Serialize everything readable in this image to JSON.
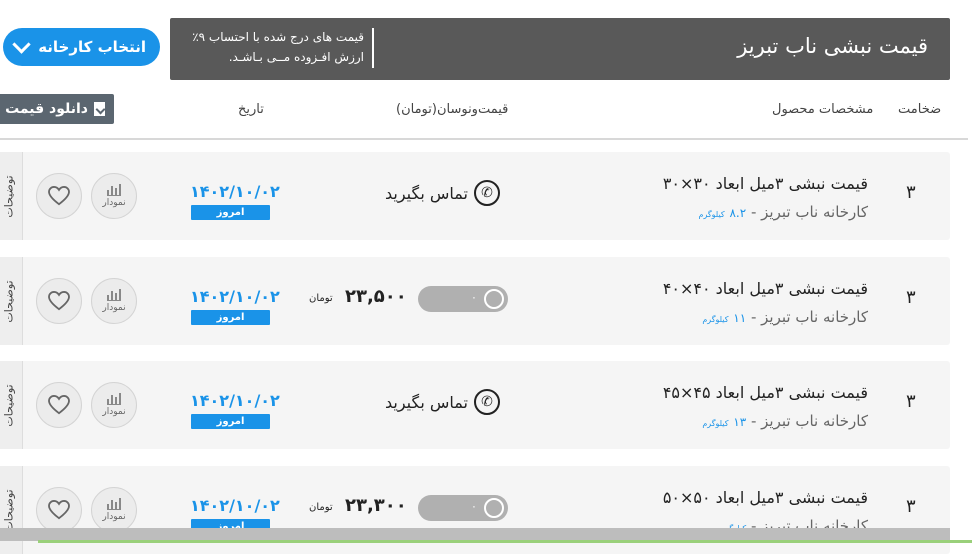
{
  "header": {
    "title": "قیمت نبشی ناب تبریز",
    "vat_note": "قیمت های درج شده با احتساب ۹٪ ارزش افـزوده مــی بـاشـد.",
    "select_factory_label": "انتخاب کارخانه"
  },
  "columns": {
    "thickness": "ضخامت",
    "product": "مشخصات محصول",
    "price": "قیمت‌ونوسان(تومان)",
    "date": "تاریخ",
    "download": "دانلود قیمت"
  },
  "labels": {
    "notes": "توضیحات",
    "chart": "نمودار",
    "today": "امروز",
    "toman": "تومان",
    "weight_unit": "کیلوگرم"
  },
  "rows": [
    {
      "thickness": "۳",
      "name": "قیمت نبشی ۳میل ابعاد ۳۰×۳۰",
      "sub": "کارخانه ناب تبریز -",
      "weight": "۸.۲",
      "date": "۱۴۰۲/۱۰/۰۲",
      "price_type": "call",
      "call_label": "تماس بگیرید"
    },
    {
      "thickness": "۳",
      "name": "قیمت نبشی ۳میل ابعاد ۴۰×۴۰",
      "sub": "کارخانه ناب تبریز -",
      "weight": "۱۱",
      "date": "۱۴۰۲/۱۰/۰۲",
      "price_type": "price",
      "price": "۲۳,۵۰۰",
      "change": "۰"
    },
    {
      "thickness": "۳",
      "name": "قیمت نبشی ۳میل ابعاد ۴۵×۴۵",
      "sub": "کارخانه ناب تبریز -",
      "weight": "۱۳",
      "date": "۱۴۰۲/۱۰/۰۲",
      "price_type": "call",
      "call_label": "تماس بگیرید"
    },
    {
      "thickness": "۳",
      "name": "قیمت نبشی ۳میل ابعاد ۵۰×۵۰",
      "sub": "کارخانه ناب تبریز -",
      "weight": "",
      "date": "۱۴۰۲/۱۰/۰۲",
      "price_type": "price",
      "price": "۲۳,۳۰۰",
      "change": "۰"
    }
  ]
}
